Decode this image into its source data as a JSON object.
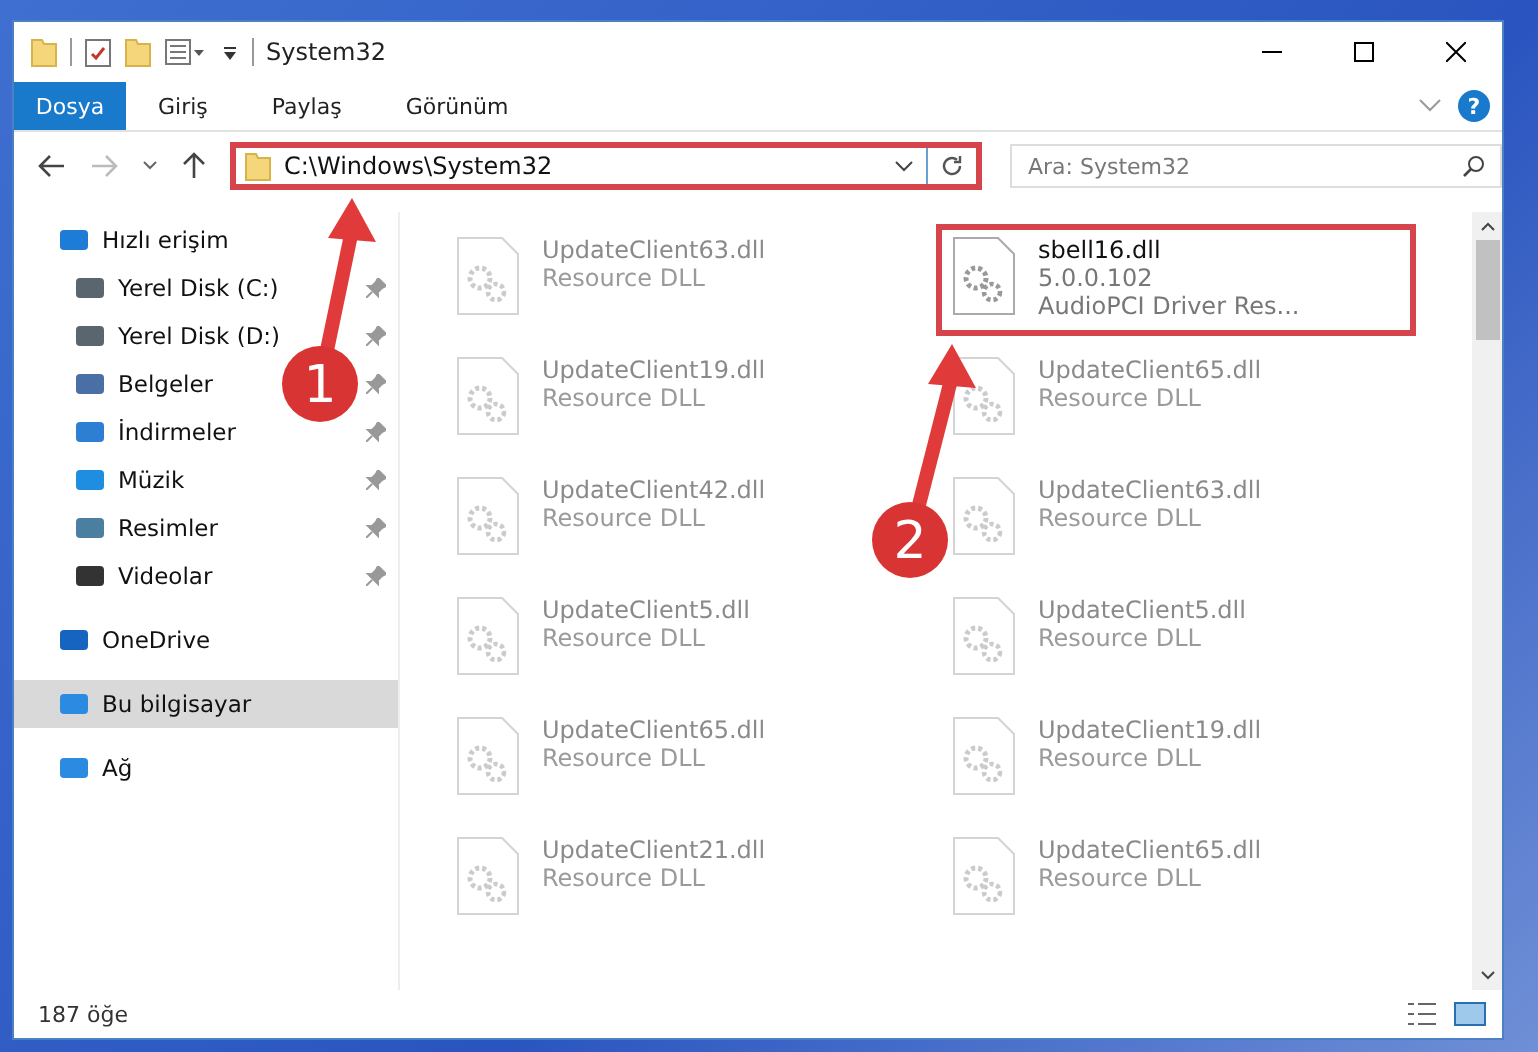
{
  "window": {
    "title": "System32"
  },
  "ribbon": {
    "file_tab": "Dosya",
    "tabs": [
      {
        "label": "Giriş",
        "selected": false
      },
      {
        "label": "Paylaş",
        "selected": false
      },
      {
        "label": "Görünüm",
        "selected": false
      }
    ],
    "help": "?"
  },
  "address": {
    "path": "C:\\Windows\\System32"
  },
  "search": {
    "placeholder": "Ara: System32"
  },
  "sidebar": {
    "items": [
      {
        "label": "Hızlı erişim",
        "selected": false,
        "children": [
          {
            "label": "Yerel Disk (C:)",
            "selected": false,
            "pinned": true
          },
          {
            "label": "Yerel Disk (D:)",
            "selected": false,
            "pinned": true
          },
          {
            "label": "Belgeler",
            "selected": false,
            "pinned": true
          },
          {
            "label": "İndirmeler",
            "selected": false,
            "pinned": true
          },
          {
            "label": "Müzik",
            "selected": false,
            "pinned": true
          },
          {
            "label": "Resimler",
            "selected": false,
            "pinned": true
          },
          {
            "label": "Videolar",
            "selected": false,
            "pinned": true
          }
        ]
      },
      {
        "label": "OneDrive",
        "selected": false
      },
      {
        "label": "Bu bilgisayar",
        "selected": true
      },
      {
        "label": "Ağ",
        "selected": false
      }
    ]
  },
  "files": [
    {
      "name": "UpdateClient63.dll",
      "detail": "Resource DLL",
      "highlighted": false
    },
    {
      "name": "sbell16.dll",
      "version": "5.0.0.102",
      "detail": "AudioPCI Driver Res...",
      "highlighted": true
    },
    {
      "name": "UpdateClient19.dll",
      "detail": "Resource DLL",
      "highlighted": false
    },
    {
      "name": "UpdateClient65.dll",
      "detail": "Resource DLL",
      "highlighted": false
    },
    {
      "name": "UpdateClient42.dll",
      "detail": "Resource DLL",
      "highlighted": false
    },
    {
      "name": "UpdateClient63.dll",
      "detail": "Resource DLL",
      "highlighted": false
    },
    {
      "name": "UpdateClient5.dll",
      "detail": "Resource DLL",
      "highlighted": false
    },
    {
      "name": "UpdateClient5.dll",
      "detail": "Resource DLL",
      "highlighted": false
    },
    {
      "name": "UpdateClient65.dll",
      "detail": "Resource DLL",
      "highlighted": false
    },
    {
      "name": "UpdateClient19.dll",
      "detail": "Resource DLL",
      "highlighted": false
    },
    {
      "name": "UpdateClient21.dll",
      "detail": "Resource DLL",
      "highlighted": false
    },
    {
      "name": "UpdateClient65.dll",
      "detail": "Resource DLL",
      "highlighted": false
    }
  ],
  "status_bar": {
    "count": "187 öğe"
  },
  "annotations": [
    {
      "number": "1"
    },
    {
      "number": "2"
    }
  ]
}
